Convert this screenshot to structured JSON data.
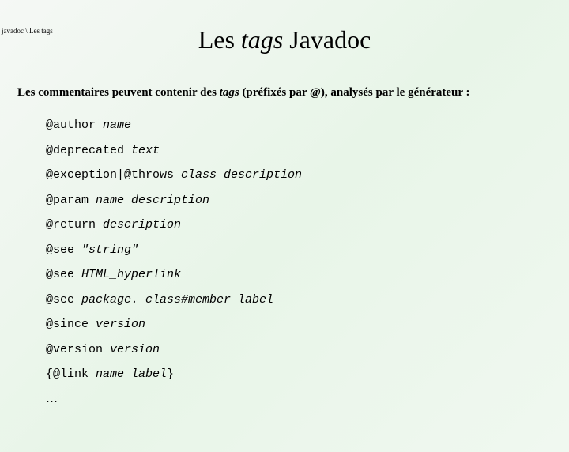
{
  "breadcrumb": "javadoc \\ Les tags",
  "title_prefix": "Les ",
  "title_italic": "tags",
  "title_suffix": " Javadoc",
  "intro_prefix": "Les commentaires peuvent contenir des ",
  "intro_italic": "tags",
  "intro_suffix": " (préfixés par @), analysés par le générateur :",
  "tags": [
    {
      "keyword": "@author ",
      "arg": "name"
    },
    {
      "keyword": "@deprecated ",
      "arg": "text"
    },
    {
      "keyword": "@exception|@throws ",
      "arg": "class description"
    },
    {
      "keyword": "@param ",
      "arg": "name description"
    },
    {
      "keyword": "@return ",
      "arg": "description"
    },
    {
      "keyword": "@see ",
      "arg": "\"string\""
    },
    {
      "keyword": "@see ",
      "arg": "HTML_hyperlink"
    },
    {
      "keyword": "@see ",
      "arg": "package. class#member label"
    },
    {
      "keyword": "@since ",
      "arg": "version"
    },
    {
      "keyword": "@version ",
      "arg": "version"
    },
    {
      "keyword": "{@link ",
      "arg": "name label",
      "suffix": "}"
    }
  ],
  "ellipsis": "…"
}
